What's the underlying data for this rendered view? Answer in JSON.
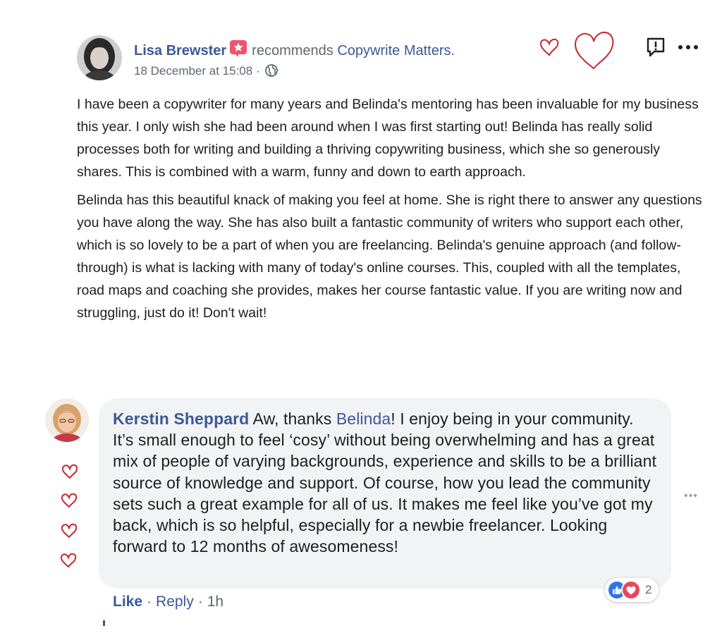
{
  "post": {
    "author": "Lisa Brewster",
    "action_text": "recommends",
    "page_name": "Copywrite Matters.",
    "timestamp": "18 December at 15:08",
    "meta_separator": "·",
    "icons": {
      "badge": "recommend-star-icon",
      "audience": "globe-icon",
      "report": "report-icon",
      "more": "more-options-icon"
    },
    "paragraphs": [
      "I have been a copywriter for many years and Belinda's mentoring has been invaluable for my business this year. I only wish she had been around when I was first starting out! Belinda has really solid processes both for writing and building a thriving copywriting business, which she so generously shares. This is combined with a warm, funny and down to earth approach.",
      "Belinda has this beautiful knack of making you feel at home. She is right there to answer any questions you have along the way. She has also built a fantastic community of writers who support each other, which is so lovely to be a part of when you are freelancing. Belinda's genuine approach (and follow-through) is what is lacking with many of today's online courses. This, coupled with all the templates, road maps and coaching she provides, makes her course fantastic value. If you are writing now and struggling, just do it! Don't wait!"
    ]
  },
  "comment": {
    "author": "Kerstin Sheppard",
    "text_before_mention": "Aw, thanks",
    "mention": "Belinda",
    "text_after_mention": "! I enjoy being in your community. It’s small enough to feel ‘cosy’ without being overwhelming and has a great mix of people of varying backgrounds, experience and skills to be a brilliant source of knowledge and support. Of course, how you lead the community sets such a great example for all of us. It makes me feel like you’ve got my back, which is so helpful, especially for a newbie freelancer. Looking forward to 12 months of awesomeness!",
    "more_icon": "•••",
    "reactions": {
      "icons": [
        "like-reaction-icon",
        "love-reaction-icon"
      ],
      "count": "2"
    },
    "actions": {
      "like": "Like",
      "reply": "Reply",
      "separator": "·",
      "time": "1h"
    }
  },
  "decorations": {
    "heart_color": "#c8282e",
    "icon": "hand-drawn-heart-icon"
  },
  "colors": {
    "link": "#3b5998",
    "bubble": "#f2f3f5",
    "meta": "#606770",
    "badge": "#f35369",
    "like": "#2e76e6",
    "love": "#ec4459"
  }
}
